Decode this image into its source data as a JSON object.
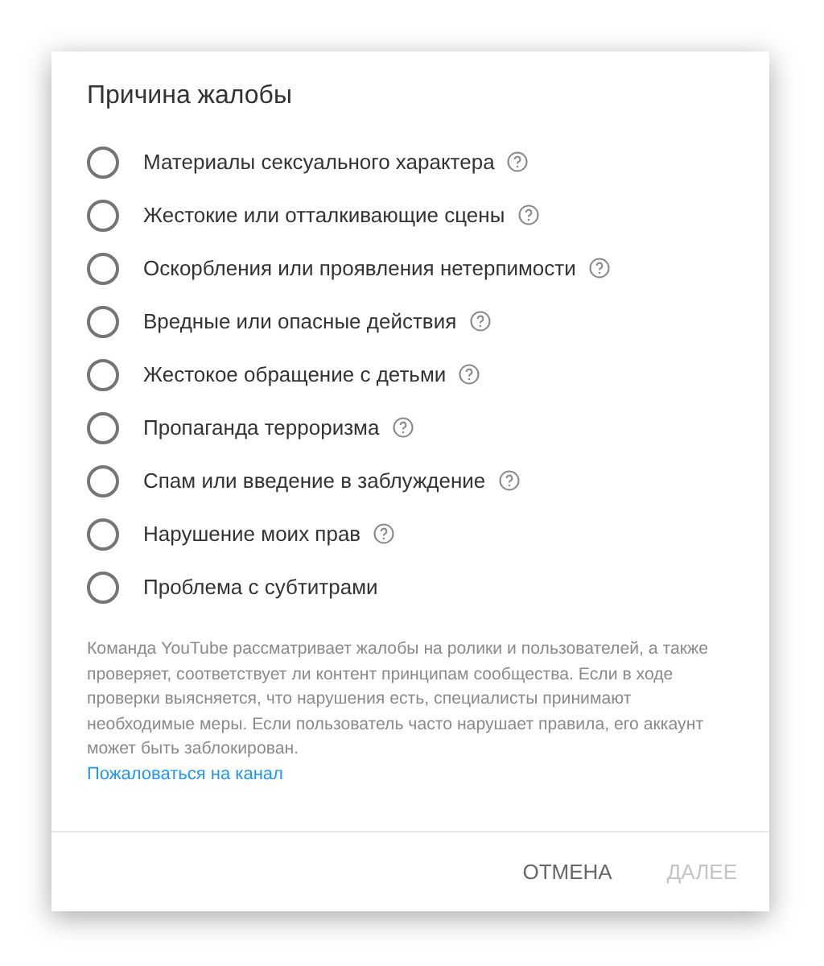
{
  "dialog": {
    "title": "Причина жалобы",
    "options": [
      {
        "label": "Материалы сексуального характера",
        "selected": false,
        "help": true
      },
      {
        "label": "Жестокие или отталкивающие сцены",
        "selected": false,
        "help": true
      },
      {
        "label": "Оскорбления или проявления нетерпимости",
        "selected": false,
        "help": true
      },
      {
        "label": "Вредные или опасные действия",
        "selected": false,
        "help": true
      },
      {
        "label": "Жестокое обращение с детьми",
        "selected": false,
        "help": true
      },
      {
        "label": "Пропаганда терроризма",
        "selected": false,
        "help": true
      },
      {
        "label": "Спам или введение в заблуждение",
        "selected": false,
        "help": true
      },
      {
        "label": "Нарушение моих прав",
        "selected": false,
        "help": true
      },
      {
        "label": "Проблема с субтитрами",
        "selected": false,
        "help": false
      }
    ],
    "description": "Команда YouTube рассматривает жалобы на ролики и пользователей, а также проверяет, соответствует ли контент принципам сообщества. Если в ходе проверки выясняется, что нарушения есть, специалисты принимают необходимые меры. Если пользователь часто нарушает правила, его аккаунт может быть заблокирован.",
    "link": "Пожаловаться на канал",
    "buttons": [
      {
        "label": "ОТМЕНА",
        "disabled": false
      },
      {
        "label": "ДАЛЕЕ",
        "disabled": true
      }
    ]
  }
}
